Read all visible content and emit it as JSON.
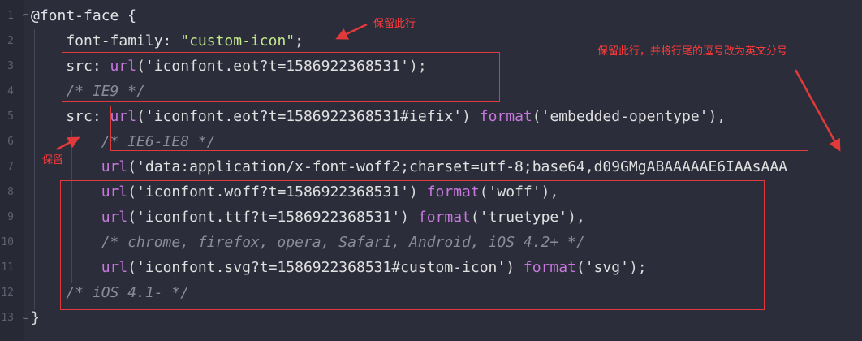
{
  "editor": {
    "line_numbers": [
      "1",
      "2",
      "3",
      "4",
      "5",
      "6",
      "7",
      "8",
      "9",
      "10",
      "11",
      "12",
      "13"
    ],
    "lines": [
      [
        {
          "t": "@font-face {",
          "c": "at"
        }
      ],
      [
        {
          "t": "    font-family: ",
          "c": "prop"
        },
        {
          "t": "\"custom-icon\"",
          "c": "str"
        },
        {
          "t": ";",
          "c": "punc"
        }
      ],
      [
        {
          "t": "    src: ",
          "c": "prop"
        },
        {
          "t": "url",
          "c": "fn"
        },
        {
          "t": "(",
          "c": "punc"
        },
        {
          "t": "'iconfont.eot?t=1586922368531'",
          "c": "sq"
        },
        {
          "t": ");",
          "c": "punc"
        }
      ],
      [
        {
          "t": "    /* IE9 */",
          "c": "cmt"
        }
      ],
      [
        {
          "t": "    src: ",
          "c": "prop"
        },
        {
          "t": "url",
          "c": "fn"
        },
        {
          "t": "(",
          "c": "punc"
        },
        {
          "t": "'iconfont.eot?t=1586922368531#iefix'",
          "c": "sq"
        },
        {
          "t": ") ",
          "c": "punc"
        },
        {
          "t": "format",
          "c": "fn"
        },
        {
          "t": "(",
          "c": "punc"
        },
        {
          "t": "'embedded-opentype'",
          "c": "sq"
        },
        {
          "t": "),",
          "c": "punc"
        }
      ],
      [
        {
          "t": "        /* IE6-IE8 */",
          "c": "cmt"
        }
      ],
      [
        {
          "t": "        ",
          "c": "punc"
        },
        {
          "t": "url",
          "c": "fn"
        },
        {
          "t": "(",
          "c": "punc"
        },
        {
          "t": "'data:application/x-font-woff2;charset=utf-8;base64,d09GMgABAAAAAE6IAAsAAA",
          "c": "sq"
        }
      ],
      [
        {
          "t": "        ",
          "c": "punc"
        },
        {
          "t": "url",
          "c": "fn"
        },
        {
          "t": "(",
          "c": "punc"
        },
        {
          "t": "'iconfont.woff?t=1586922368531'",
          "c": "sq"
        },
        {
          "t": ") ",
          "c": "punc"
        },
        {
          "t": "format",
          "c": "fn"
        },
        {
          "t": "(",
          "c": "punc"
        },
        {
          "t": "'woff'",
          "c": "sq"
        },
        {
          "t": "),",
          "c": "punc"
        }
      ],
      [
        {
          "t": "        ",
          "c": "punc"
        },
        {
          "t": "url",
          "c": "fn"
        },
        {
          "t": "(",
          "c": "punc"
        },
        {
          "t": "'iconfont.ttf?t=1586922368531'",
          "c": "sq"
        },
        {
          "t": ") ",
          "c": "punc"
        },
        {
          "t": "format",
          "c": "fn"
        },
        {
          "t": "(",
          "c": "punc"
        },
        {
          "t": "'truetype'",
          "c": "sq"
        },
        {
          "t": "),",
          "c": "punc"
        }
      ],
      [
        {
          "t": "        /* chrome, firefox, opera, Safari, Android, iOS 4.2+ */",
          "c": "cmt"
        }
      ],
      [
        {
          "t": "        ",
          "c": "punc"
        },
        {
          "t": "url",
          "c": "fn"
        },
        {
          "t": "(",
          "c": "punc"
        },
        {
          "t": "'iconfont.svg?t=1586922368531#custom-icon'",
          "c": "sq"
        },
        {
          "t": ") ",
          "c": "punc"
        },
        {
          "t": "format",
          "c": "fn"
        },
        {
          "t": "(",
          "c": "punc"
        },
        {
          "t": "'svg'",
          "c": "sq"
        },
        {
          "t": ");",
          "c": "punc"
        }
      ],
      [
        {
          "t": "    /* iOS 4.1- */",
          "c": "cmt"
        }
      ],
      [
        {
          "t": "}",
          "c": "punc"
        }
      ]
    ]
  },
  "annotations": {
    "keep_line": "保留此行",
    "keep_line_change_comma": "保留此行，并将行尾的逗号改为英文分号",
    "keep": "保留"
  },
  "colors": {
    "background": "#2b2d3a",
    "annotation_red": "#e13a3a"
  }
}
